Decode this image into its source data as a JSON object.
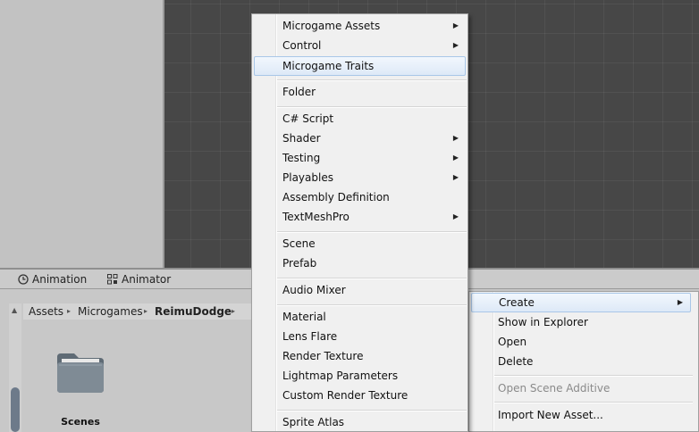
{
  "tabs": [
    {
      "label": "Animation",
      "icon": "clock-icon"
    },
    {
      "label": "Animator",
      "icon": "animator-icon"
    }
  ],
  "breadcrumb": [
    "Assets",
    "Microgames",
    "ReimuDodge"
  ],
  "breadcrumb_separator": "▸",
  "folder": {
    "label": "Scenes",
    "icon": "folder-icon"
  },
  "submenu_arrow": "▶",
  "main_menu": {
    "items": [
      {
        "label": "Microgame Assets",
        "submenu": true
      },
      {
        "label": "Control",
        "submenu": true
      },
      {
        "label": "Microgame Traits",
        "submenu": false,
        "highlighted": true
      },
      {
        "label": "Folder"
      },
      {
        "label": "C# Script"
      },
      {
        "label": "Shader",
        "submenu": true
      },
      {
        "label": "Testing",
        "submenu": true
      },
      {
        "label": "Playables",
        "submenu": true
      },
      {
        "label": "Assembly Definition"
      },
      {
        "label": "TextMeshPro",
        "submenu": true
      },
      {
        "label": "Scene"
      },
      {
        "label": "Prefab"
      },
      {
        "label": "Audio Mixer"
      },
      {
        "label": "Material"
      },
      {
        "label": "Lens Flare"
      },
      {
        "label": "Render Texture"
      },
      {
        "label": "Lightmap Parameters"
      },
      {
        "label": "Custom Render Texture"
      },
      {
        "label": "Sprite Atlas"
      }
    ]
  },
  "context_menu": {
    "items": [
      {
        "label": "Create",
        "submenu": true,
        "highlighted": true
      },
      {
        "label": "Show in Explorer"
      },
      {
        "label": "Open"
      },
      {
        "label": "Delete"
      },
      {
        "label": "Open Scene Additive",
        "disabled": true
      },
      {
        "label": "Import New Asset..."
      }
    ]
  },
  "colors": {
    "scene_bg": "#474747",
    "menu_bg": "#f0f0f0",
    "highlight_border": "#a9c7e8",
    "scroll_thumb": "#6d7a8a",
    "folder": "#7f8b95"
  }
}
